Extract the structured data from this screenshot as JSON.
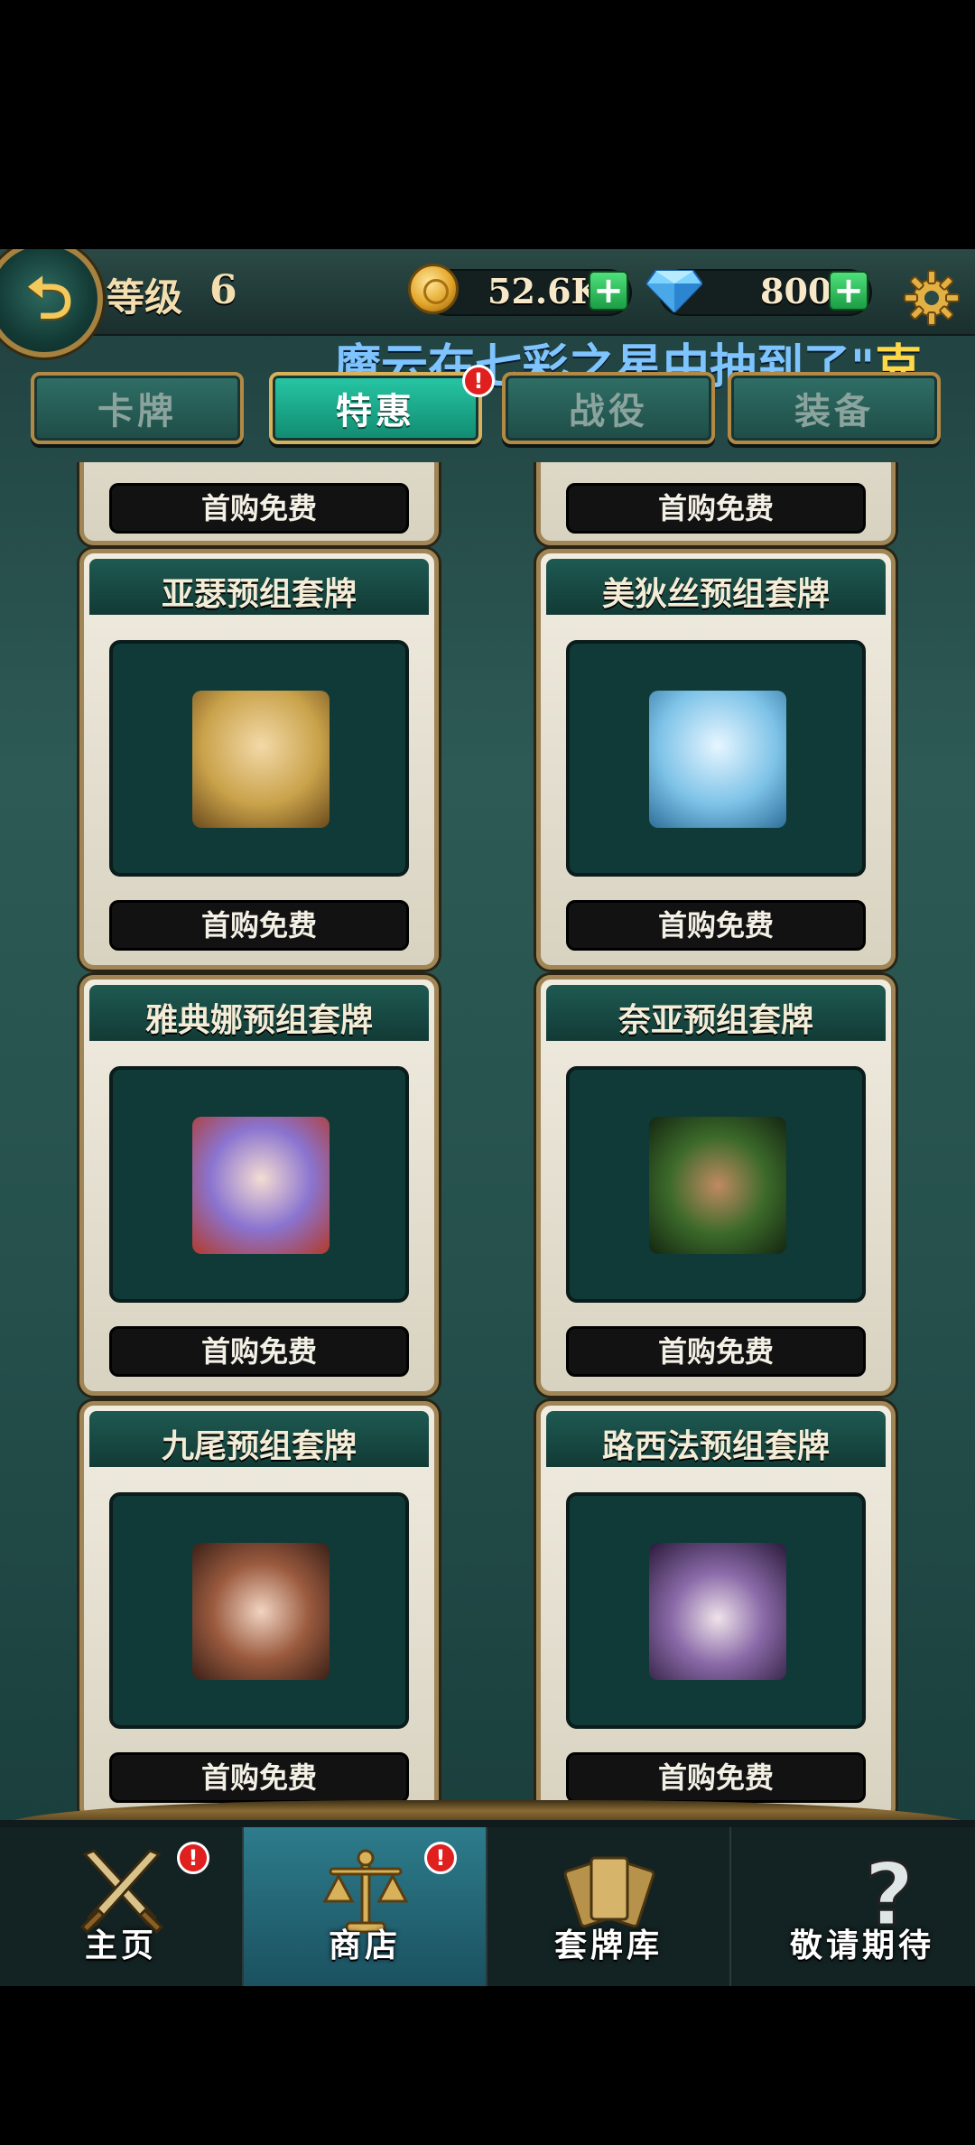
{
  "header": {
    "level_label": "等级",
    "level_value": "6",
    "gold": "52.6K",
    "gems": "800",
    "plus_glyph": "+",
    "back_glyph": "⮌"
  },
  "ticker": {
    "prefix": "魔云在七彩之星中抽到了\"",
    "tail": "克"
  },
  "tabs": [
    {
      "label": "卡牌"
    },
    {
      "label": "特惠"
    },
    {
      "label": "战役"
    },
    {
      "label": "装备"
    }
  ],
  "tab_badge": "!",
  "offers": [
    {
      "title": "",
      "button": "首购免费"
    },
    {
      "title": "",
      "button": "首购免费"
    },
    {
      "title": "亚瑟预组套牌",
      "button": "首购免费",
      "portrait_color": "#c9a24a"
    },
    {
      "title": "美狄丝预组套牌",
      "button": "首购免费",
      "portrait_color": "#7ec3e8"
    },
    {
      "title": "雅典娜预组套牌",
      "button": "首购免费",
      "portrait_color": "#6f5ac0"
    },
    {
      "title": "奈亚预组套牌",
      "button": "首购免费",
      "portrait_color": "#2f5a2a"
    },
    {
      "title": "九尾预组套牌",
      "button": "首购免费",
      "portrait_color": "#9a5a3e"
    },
    {
      "title": "路西法预组套牌",
      "button": "首购免费",
      "portrait_color": "#5a3f7c"
    }
  ],
  "nav": [
    {
      "label": "主页",
      "badge": "!"
    },
    {
      "label": "商店",
      "badge": "!"
    },
    {
      "label": "套牌库"
    },
    {
      "label": "敬请期待"
    }
  ],
  "colors": {
    "accent_gold": "#b28a45",
    "active_tab": "#27c7a5",
    "ticker_blue": "#7ec4ff",
    "ticker_yellow": "#ffd84a"
  }
}
